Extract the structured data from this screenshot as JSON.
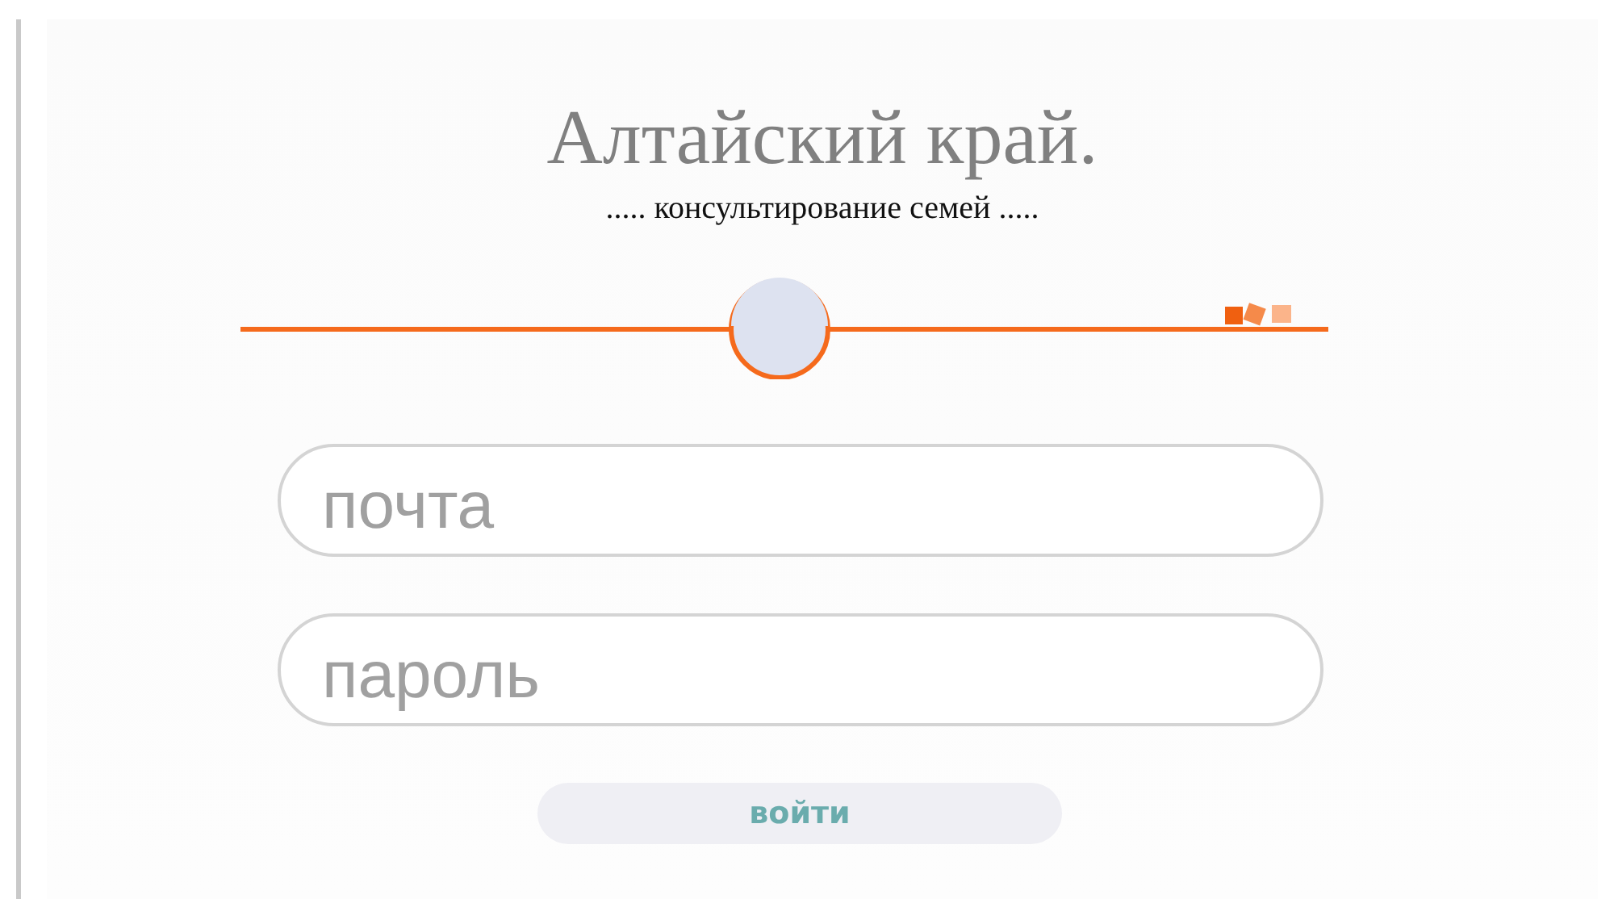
{
  "title": "Алтайский край.",
  "subtitle": "..... консультирование семей .....",
  "fields": [
    {
      "placeholder": "почта"
    },
    {
      "placeholder": "пароль"
    }
  ],
  "button": "войти"
}
